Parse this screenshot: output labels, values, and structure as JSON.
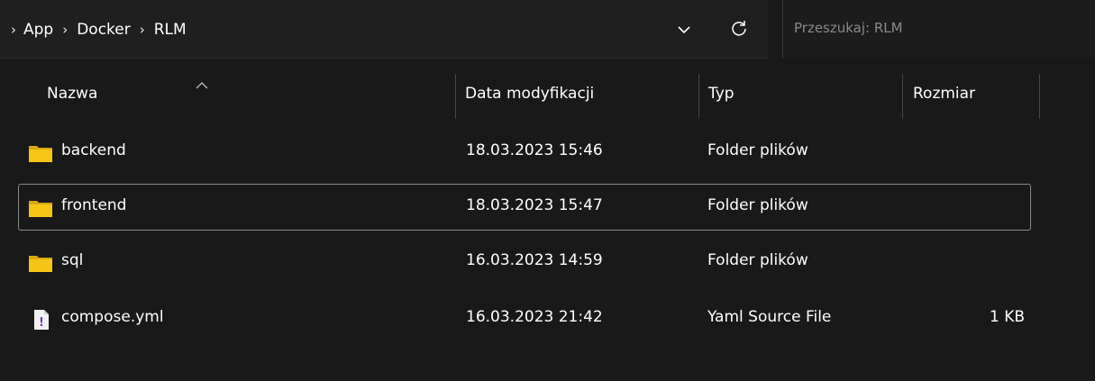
{
  "address_bar": {
    "breadcrumbs": [
      "App",
      "Docker",
      "RLM"
    ],
    "dropdown_icon": "chevron-down-icon",
    "refresh_icon": "refresh-icon"
  },
  "search": {
    "placeholder": "Przeszukaj: RLM"
  },
  "columns": {
    "name": "Nazwa",
    "date": "Data modyfikacji",
    "type": "Typ",
    "size": "Rozmiar"
  },
  "files": [
    {
      "name": "backend",
      "date": "18.03.2023 15:46",
      "type": "Folder plików",
      "size": "",
      "icon": "folder-icon"
    },
    {
      "name": "frontend",
      "date": "18.03.2023 15:47",
      "type": "Folder plików",
      "size": "",
      "icon": "folder-icon",
      "selected": true
    },
    {
      "name": "sql",
      "date": "16.03.2023 14:59",
      "type": "Folder plików",
      "size": "",
      "icon": "folder-icon"
    },
    {
      "name": "compose.yml",
      "date": "16.03.2023 21:42",
      "type": "Yaml Source File",
      "size": "1 KB",
      "icon": "yaml-file-icon"
    }
  ],
  "colors": {
    "background": "#191919",
    "folder": "#f5c518",
    "selection_border": "#8a8a8a"
  }
}
